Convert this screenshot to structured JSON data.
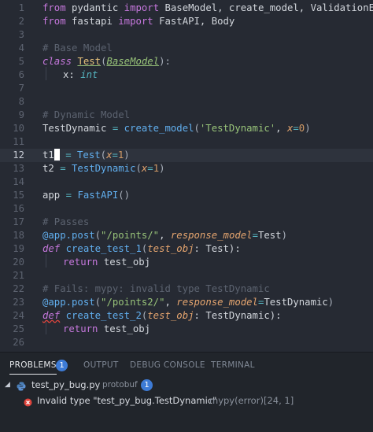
{
  "editor": {
    "lines": [
      {
        "n": "1"
      },
      {
        "n": "2"
      },
      {
        "n": "3"
      },
      {
        "n": "4"
      },
      {
        "n": "5"
      },
      {
        "n": "6"
      },
      {
        "n": "7"
      },
      {
        "n": "8"
      },
      {
        "n": "9"
      },
      {
        "n": "10"
      },
      {
        "n": "11"
      },
      {
        "n": "12"
      },
      {
        "n": "13"
      },
      {
        "n": "14"
      },
      {
        "n": "15"
      },
      {
        "n": "16"
      },
      {
        "n": "17"
      },
      {
        "n": "18"
      },
      {
        "n": "19"
      },
      {
        "n": "20"
      },
      {
        "n": "21"
      },
      {
        "n": "22"
      },
      {
        "n": "23"
      },
      {
        "n": "24"
      },
      {
        "n": "25"
      },
      {
        "n": "26"
      }
    ],
    "code": {
      "l1": [
        "from",
        " pydantic ",
        "import",
        " BaseModel, create_model, ValidationError"
      ],
      "l2": [
        "from",
        " fastapi ",
        "import",
        " FastAPI, Body"
      ],
      "l4": "# Base Model",
      "l5": [
        "class",
        " ",
        "Test",
        "(",
        "BaseModel",
        "):"
      ],
      "l6": [
        "x",
        ": ",
        "int"
      ],
      "l9": "# Dynamic Model",
      "l10": [
        "TestDynamic",
        " ",
        "=",
        " ",
        "create_model",
        "(",
        "'TestDynamic'",
        ", ",
        "x",
        "=",
        "0",
        ")"
      ],
      "l12": [
        "t1",
        "",
        " = ",
        "Test",
        "(",
        "x",
        "=",
        "1",
        ")"
      ],
      "l13": [
        "t2",
        " = ",
        "TestDynamic",
        "(",
        "x",
        "=",
        "1",
        ")"
      ],
      "l15": [
        "app",
        " = ",
        "FastAPI",
        "()"
      ],
      "l17": "# Passes",
      "l18": [
        "@app.post",
        "(",
        "\"/points/\"",
        ", ",
        "response_model",
        "=",
        "Test",
        ")"
      ],
      "l19": [
        "def",
        " ",
        "create_test_1",
        "(",
        "test_obj",
        ": Test):"
      ],
      "l20": [
        "return",
        " test_obj"
      ],
      "l22": "# Fails: mypy: invalid type TestDynamic",
      "l23": [
        "@app.post",
        "(",
        "\"/points2/\"",
        ", ",
        "response_model",
        "=",
        "TestDynamic",
        ")"
      ],
      "l24": [
        "def",
        " ",
        "create_test_2",
        "(",
        "test_obj",
        ": TestDynamic):"
      ],
      "l25": [
        "return",
        " test_obj"
      ]
    }
  },
  "panel": {
    "tabs": [
      {
        "label": "PROBLEMS",
        "badge": "1"
      },
      {
        "label": "OUTPUT"
      },
      {
        "label": "DEBUG CONSOLE"
      },
      {
        "label": "TERMINAL"
      }
    ],
    "file": {
      "name": "test_py_bug.py",
      "folder": "protobuf",
      "badge": "1"
    },
    "problem": {
      "message": "Invalid type \"test_py_bug.TestDynamic\"",
      "source": "mypy(error)",
      "location": "[24, 1]"
    }
  },
  "colors": {
    "error": "#e0453d",
    "accent": "#3d7bd6",
    "background": "#262a33"
  }
}
